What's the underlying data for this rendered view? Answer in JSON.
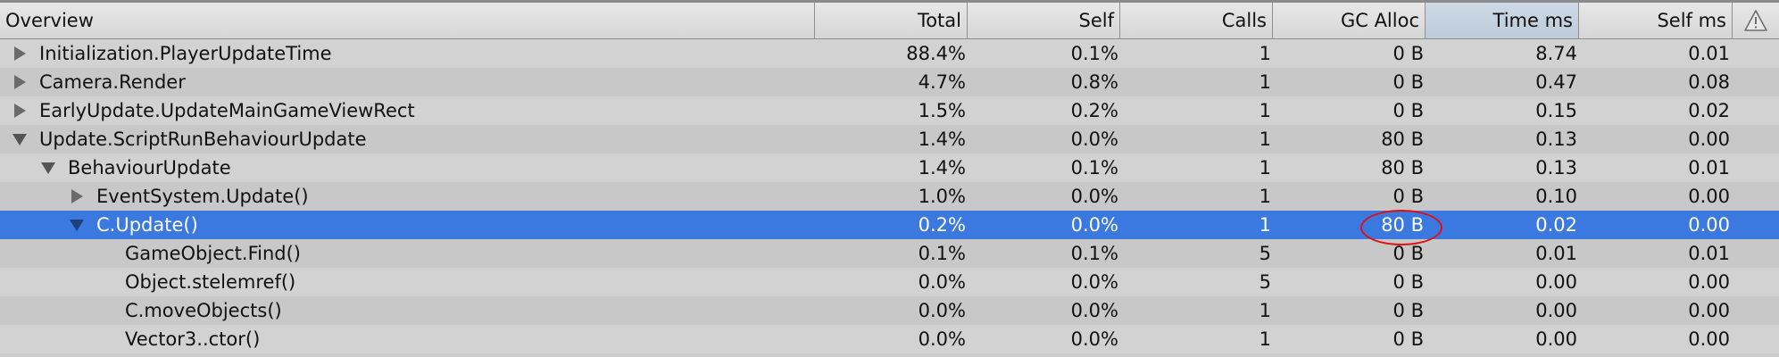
{
  "columns": {
    "overview": "Overview",
    "total": "Total",
    "self": "Self",
    "calls": "Calls",
    "gc_alloc": "GC Alloc",
    "time_ms": "Time ms",
    "self_ms": "Self ms",
    "warning_icon": "warning-triangle"
  },
  "rows": [
    {
      "name": "Initialization.PlayerUpdateTime",
      "total": "88.4%",
      "self": "0.1%",
      "calls": "1",
      "gc": "0 B",
      "time": "8.74",
      "selfms": "0.01"
    },
    {
      "name": "Camera.Render",
      "total": "4.7%",
      "self": "0.8%",
      "calls": "1",
      "gc": "0 B",
      "time": "0.47",
      "selfms": "0.08"
    },
    {
      "name": "EarlyUpdate.UpdateMainGameViewRect",
      "total": "1.5%",
      "self": "0.2%",
      "calls": "1",
      "gc": "0 B",
      "time": "0.15",
      "selfms": "0.02"
    },
    {
      "name": "Update.ScriptRunBehaviourUpdate",
      "total": "1.4%",
      "self": "0.0%",
      "calls": "1",
      "gc": "80 B",
      "time": "0.13",
      "selfms": "0.00"
    },
    {
      "name": "BehaviourUpdate",
      "total": "1.4%",
      "self": "0.1%",
      "calls": "1",
      "gc": "80 B",
      "time": "0.13",
      "selfms": "0.01"
    },
    {
      "name": "EventSystem.Update()",
      "total": "1.0%",
      "self": "0.0%",
      "calls": "1",
      "gc": "0 B",
      "time": "0.10",
      "selfms": "0.00"
    },
    {
      "name": "C.Update()",
      "total": "0.2%",
      "self": "0.0%",
      "calls": "1",
      "gc": "80 B",
      "time": "0.02",
      "selfms": "0.00"
    },
    {
      "name": "GameObject.Find()",
      "total": "0.1%",
      "self": "0.1%",
      "calls": "5",
      "gc": "0 B",
      "time": "0.01",
      "selfms": "0.01"
    },
    {
      "name": "Object.stelemref()",
      "total": "0.0%",
      "self": "0.0%",
      "calls": "5",
      "gc": "0 B",
      "time": "0.00",
      "selfms": "0.00"
    },
    {
      "name": "C.moveObjects()",
      "total": "0.0%",
      "self": "0.0%",
      "calls": "1",
      "gc": "0 B",
      "time": "0.00",
      "selfms": "0.00"
    },
    {
      "name": "Vector3..ctor()",
      "total": "0.0%",
      "self": "0.0%",
      "calls": "1",
      "gc": "0 B",
      "time": "0.00",
      "selfms": "0.00"
    }
  ],
  "colors": {
    "selected_row": "#3b79e0",
    "sorted_header": "#c4d1de",
    "annotation_circle": "#e01010"
  }
}
